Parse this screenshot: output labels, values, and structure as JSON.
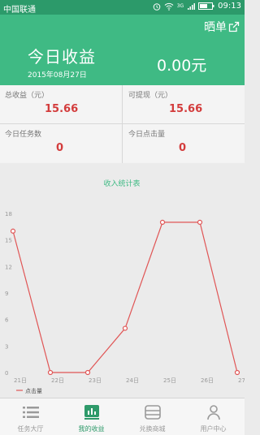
{
  "status_bar": {
    "carrier": "中国联通",
    "time": "09:13",
    "network": "3G"
  },
  "header": {
    "share_label": "晒单",
    "title": "今日收益",
    "date": "2015年08月27日",
    "amount": "0.00元"
  },
  "stats": [
    {
      "label": "总收益（元）",
      "value": "15.66"
    },
    {
      "label": "可提现（元）",
      "value": "15.66"
    },
    {
      "label": "今日任务数",
      "value": "0"
    },
    {
      "label": "今日点击量",
      "value": "0"
    }
  ],
  "chart_data": {
    "type": "line",
    "title": "收入统计表",
    "categories": [
      "21日",
      "22日",
      "23日",
      "24日",
      "25日",
      "26日",
      "27日"
    ],
    "series": [
      {
        "name": "点击量",
        "values": [
          16,
          0,
          0,
          5,
          17,
          17,
          0
        ]
      }
    ],
    "ylim": [
      0,
      18
    ],
    "yticks": [
      0,
      3,
      6,
      9,
      12,
      15,
      18
    ],
    "grid": false,
    "legend": "bottom-left",
    "colors": {
      "line": "#e05555",
      "title": "#3fba84",
      "axis": "#999999"
    }
  },
  "bottom_nav": [
    {
      "label": "任务大厅",
      "icon": "list-icon",
      "active": false
    },
    {
      "label": "我的收益",
      "icon": "chart-icon",
      "active": true
    },
    {
      "label": "兑换商城",
      "icon": "box-icon",
      "active": false
    },
    {
      "label": "用户中心",
      "icon": "user-icon",
      "active": false
    }
  ],
  "colors": {
    "header": "#3fba84",
    "status_bar": "#2c9a6a",
    "value_red": "#d33c3c"
  }
}
